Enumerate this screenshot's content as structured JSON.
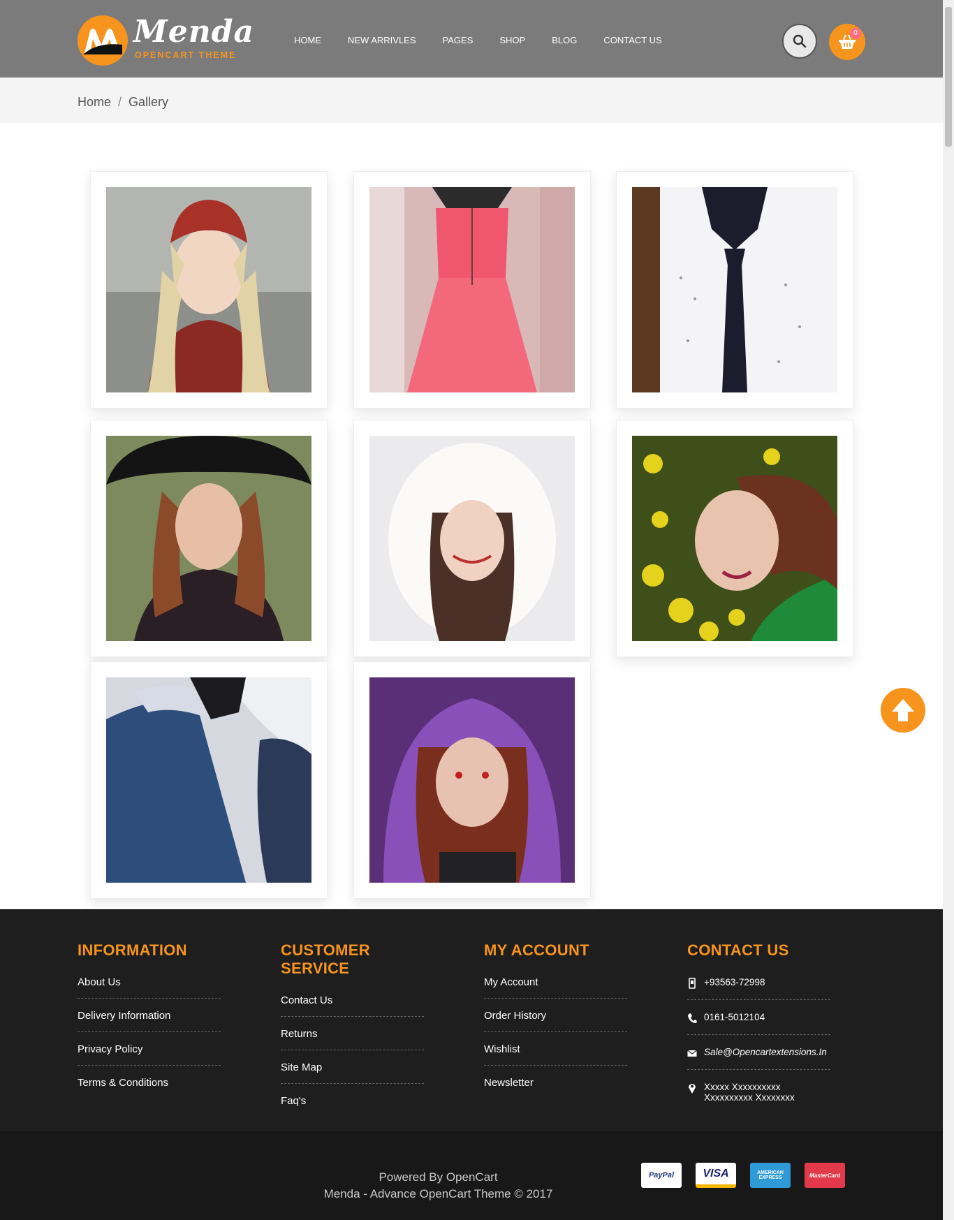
{
  "brand": {
    "name": "Menda",
    "tagline": "OPENCART THEME"
  },
  "nav": [
    "HOME",
    "NEW ARRIVLES",
    "PAGES",
    "SHOP",
    "BLOG",
    "CONTACT US"
  ],
  "cart": {
    "count": "0"
  },
  "breadcrumb": {
    "home": "Home",
    "separator": "/",
    "current": "Gallery"
  },
  "gallery": [
    {
      "subject": "girl-red-hat"
    },
    {
      "subject": "pink-dress"
    },
    {
      "subject": "shirt-and-tie"
    },
    {
      "subject": "woman-black-hat"
    },
    {
      "subject": "woman-white-fur-hood"
    },
    {
      "subject": "woman-yellow-flowers"
    },
    {
      "subject": "blue-suit"
    },
    {
      "subject": "woman-purple-hood"
    }
  ],
  "footer": {
    "information": {
      "title": "INFORMATION",
      "links": [
        "About Us",
        "Delivery Information",
        "Privacy Policy",
        "Terms & Conditions"
      ]
    },
    "customer_service": {
      "title": "CUSTOMER SERVICE",
      "links": [
        "Contact Us",
        "Returns",
        "Site Map",
        "Faq's"
      ]
    },
    "my_account": {
      "title": "MY ACCOUNT",
      "links": [
        "My Account",
        "Order History",
        "Wishlist",
        "Newsletter"
      ]
    },
    "contact": {
      "title": "CONTACT US",
      "mobile": "+93563-72998",
      "phone": "0161-5012104",
      "email": "Sale@Opencartextensions.In",
      "address_line1": "Xxxxx Xxxxxxxxxx",
      "address_line2": "Xxxxxxxxxx Xxxxxxxx"
    },
    "powered_by": "Powered By OpenCart",
    "copyright": "Menda - Advance OpenCart Theme © 2017",
    "payments": [
      "PayPal",
      "VISA",
      "AMERICAN EXPRESS",
      "MasterCard"
    ]
  },
  "colors": {
    "accent": "#f7941d",
    "header": "#7b7b7b",
    "footer": "#1e1e1e"
  }
}
